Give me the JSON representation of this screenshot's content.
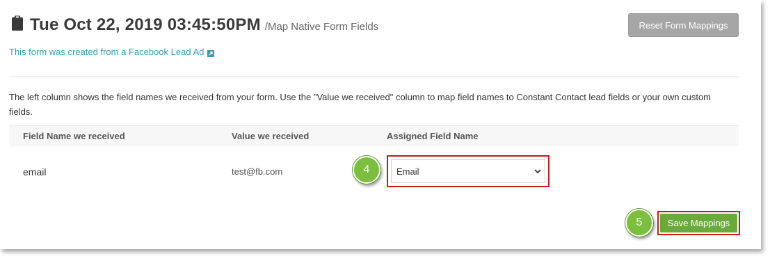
{
  "header": {
    "title": "Tue Oct 22, 2019 03:45:50PM",
    "subtitle": "/Map Native Form Fields",
    "reset_label": "Reset Form Mappings"
  },
  "source_link": {
    "text": "This form was created from a Facebook Lead Ad",
    "icon": "external-link-icon"
  },
  "description": "The left column shows the field names we received from your form. Use the \"Value we received\" column to map field names to Constant Contact lead fields or your own custom fields.",
  "table": {
    "columns": [
      "Field Name we received",
      "Value we received",
      "Assigned Field Name"
    ],
    "rows": [
      {
        "field_name": "email",
        "value": "test@fb.com",
        "assigned": "Email"
      }
    ]
  },
  "callouts": [
    "4",
    "5"
  ],
  "save_label": "Save Mappings",
  "colors": {
    "accent_green": "#6aaa3a",
    "callout_green": "#7cbf3e",
    "highlight_red": "#d0161e",
    "link": "#3a9cb0",
    "reset_gray": "#a6a6a6"
  }
}
